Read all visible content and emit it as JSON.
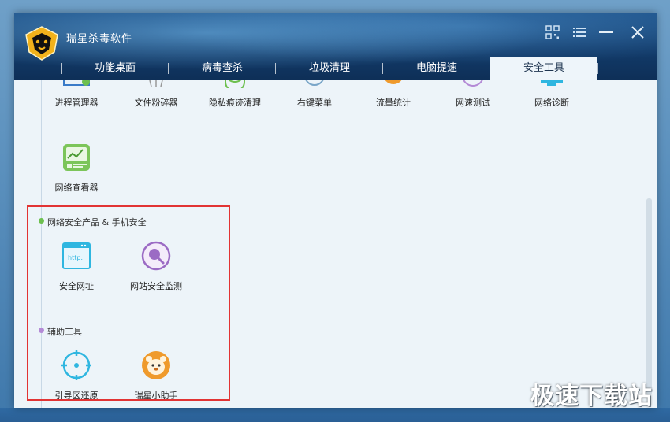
{
  "app": {
    "title": "瑞星杀毒软件"
  },
  "tabs": [
    {
      "label": "功能桌面"
    },
    {
      "label": "病毒查杀"
    },
    {
      "label": "垃圾清理"
    },
    {
      "label": "电脑提速"
    },
    {
      "label": "安全工具",
      "active": true
    }
  ],
  "tools_row": [
    {
      "label": "进程管理器",
      "icon": "process-manager-icon"
    },
    {
      "label": "文件粉碎器",
      "icon": "file-shredder-icon"
    },
    {
      "label": "隐私痕迹清理",
      "icon": "privacy-cleaner-icon"
    },
    {
      "label": "右键菜单",
      "icon": "context-menu-icon"
    },
    {
      "label": "流量统计",
      "icon": "traffic-stats-icon"
    },
    {
      "label": "网速测试",
      "icon": "speed-test-icon"
    },
    {
      "label": "网络诊断",
      "icon": "network-diagnosis-icon"
    }
  ],
  "tools_row2": [
    {
      "label": "网络查看器",
      "icon": "network-viewer-icon"
    }
  ],
  "sections": [
    {
      "title": "网络安全产品 & 手机安全",
      "items": [
        {
          "label": "安全网址",
          "icon": "http-browser-icon",
          "icon_text": "http:"
        },
        {
          "label": "网站安全监测",
          "icon": "magnifier-icon"
        }
      ]
    },
    {
      "title": "辅助工具",
      "items": [
        {
          "label": "引导区还原",
          "icon": "crosshair-icon"
        },
        {
          "label": "瑞星小助手",
          "icon": "lion-mascot-icon"
        }
      ]
    }
  ],
  "watermark": "极速下载站",
  "colors": {
    "accent": "#1b4f86",
    "highlight": "#e23434",
    "green": "#6dc04f",
    "purple": "#9b6bc4",
    "cyan": "#2fb6e0",
    "orange": "#ef9a2c"
  }
}
